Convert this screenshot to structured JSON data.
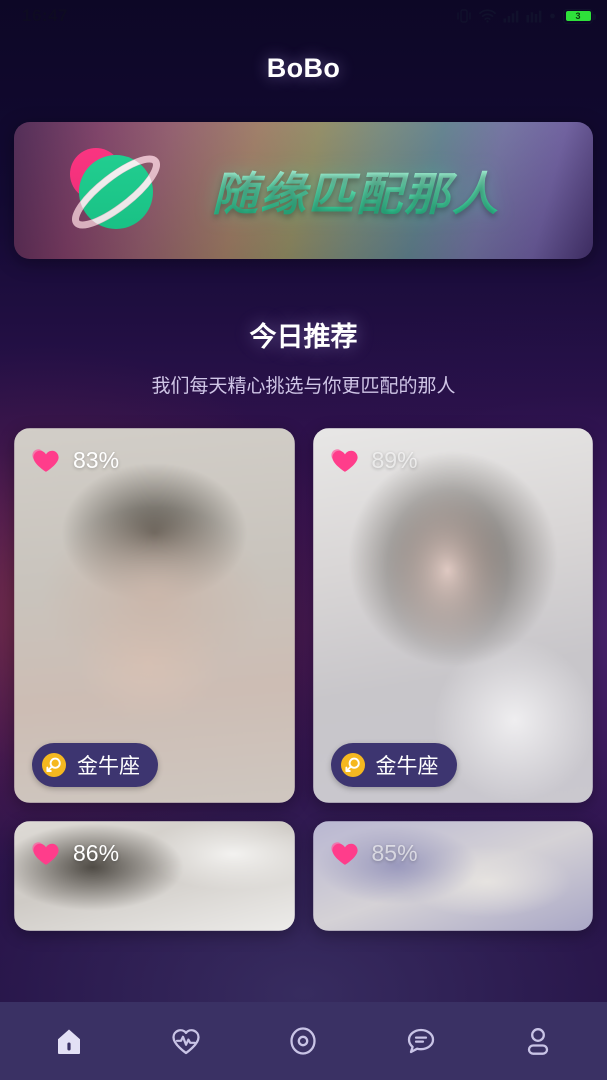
{
  "status_bar": {
    "time": "16:47",
    "icons": [
      "vibrate-icon",
      "wifi-icon",
      "signal-icon",
      "signal-alt-icon",
      "dot-icon"
    ],
    "battery_level": "3"
  },
  "header": {
    "title": "BoBo"
  },
  "banner": {
    "text": "随缘匹配那人",
    "icon": "planet-icon",
    "planet_color": "#19d18f",
    "accent_color": "#ff3d8b"
  },
  "section": {
    "title": "今日推荐",
    "subtitle": "我们每天精心挑选与你更匹配的那人"
  },
  "cards": [
    {
      "match": "83%",
      "zodiac": "金牛座",
      "icon": "heart-icon",
      "zodiac_icon": "taurus-icon",
      "faded": false
    },
    {
      "match": "89%",
      "zodiac": "金牛座",
      "icon": "heart-icon",
      "zodiac_icon": "taurus-icon",
      "faded": true
    },
    {
      "match": "86%",
      "zodiac": "",
      "icon": "heart-icon",
      "zodiac_icon": "taurus-icon",
      "faded": false
    },
    {
      "match": "85%",
      "zodiac": "",
      "icon": "heart-icon",
      "zodiac_icon": "taurus-icon",
      "faded": true
    }
  ],
  "nav": {
    "items": [
      {
        "name": "home",
        "icon": "home-icon",
        "active": true
      },
      {
        "name": "pulse",
        "icon": "heart-pulse-icon",
        "active": false
      },
      {
        "name": "discover",
        "icon": "target-circle-icon",
        "active": false
      },
      {
        "name": "messages",
        "icon": "chat-bubble-icon",
        "active": false
      },
      {
        "name": "profile",
        "icon": "person-icon",
        "active": false
      }
    ]
  },
  "colors": {
    "accent_pink": "#ff3d8b",
    "accent_green": "#19d18f",
    "nav_bg": "#3a3164",
    "zodiac_badge": "#3d3570",
    "zodiac_icon": "#f5b820"
  }
}
